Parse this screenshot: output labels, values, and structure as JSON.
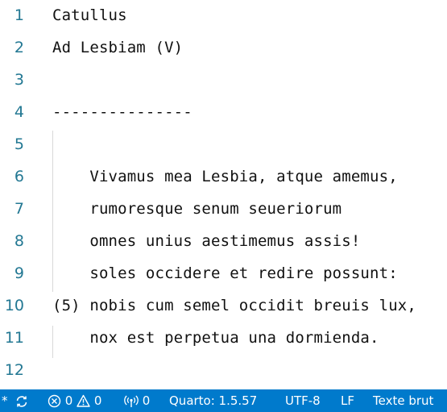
{
  "editor": {
    "lines": [
      {
        "number": "1",
        "text": "Catullus"
      },
      {
        "number": "2",
        "text": "Ad Lesbiam (V)"
      },
      {
        "number": "3",
        "text": ""
      },
      {
        "number": "4",
        "text": "---------------"
      },
      {
        "number": "5",
        "text": ""
      },
      {
        "number": "6",
        "text": "    Vivamus mea Lesbia, atque amemus,"
      },
      {
        "number": "7",
        "text": "    rumoresque senum seueriorum"
      },
      {
        "number": "8",
        "text": "    omnes unius aestimemus assis!"
      },
      {
        "number": "9",
        "text": "    soles occidere et redire possunt:"
      },
      {
        "number": "10",
        "text": "(5) nobis cum semel occidit breuis lux,"
      },
      {
        "number": "11",
        "text": "    nox est perpetua una dormienda."
      },
      {
        "number": "12",
        "text": ""
      }
    ]
  },
  "statusbar": {
    "remote_indicator": "*",
    "errors_count": "0",
    "warnings_count": "0",
    "ports_count": "0",
    "quarto_version": "Quarto: 1.5.57",
    "encoding": "UTF-8",
    "eol": "LF",
    "language_mode": "Texte brut"
  },
  "colors": {
    "statusbar_bg": "#007acc",
    "line_number": "#237893",
    "text": "#111111"
  }
}
